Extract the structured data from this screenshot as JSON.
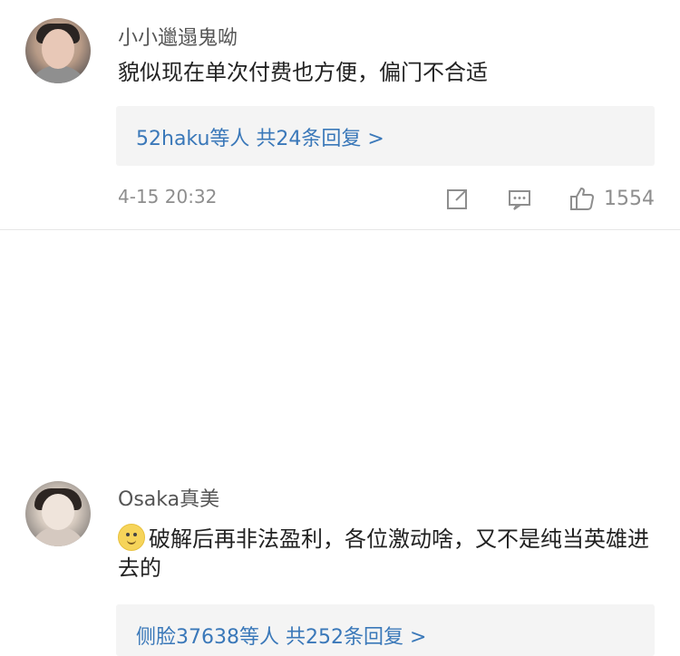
{
  "comments": [
    {
      "author": "小小邋遢鬼呦",
      "text": "貌似现在单次付费也方便，偏门不合适",
      "reply_preview": "52haku等人  共24条回复 >",
      "timestamp": "4-15 20:32",
      "like_count": "1554",
      "icons": {
        "share": "share-icon",
        "comment": "comment-icon",
        "like": "like-icon"
      }
    },
    {
      "author": "Osaka真美",
      "text": "破解后再非法盈利，各位激动啥，又不是纯当英雄进去的",
      "reply_preview": "侧脸37638等人  共252条回复 >",
      "emoji": "smile-emoji"
    }
  ],
  "colors": {
    "link": "#3a78b9",
    "meta": "#8e8e8e",
    "reply_bg": "#f4f4f4"
  }
}
